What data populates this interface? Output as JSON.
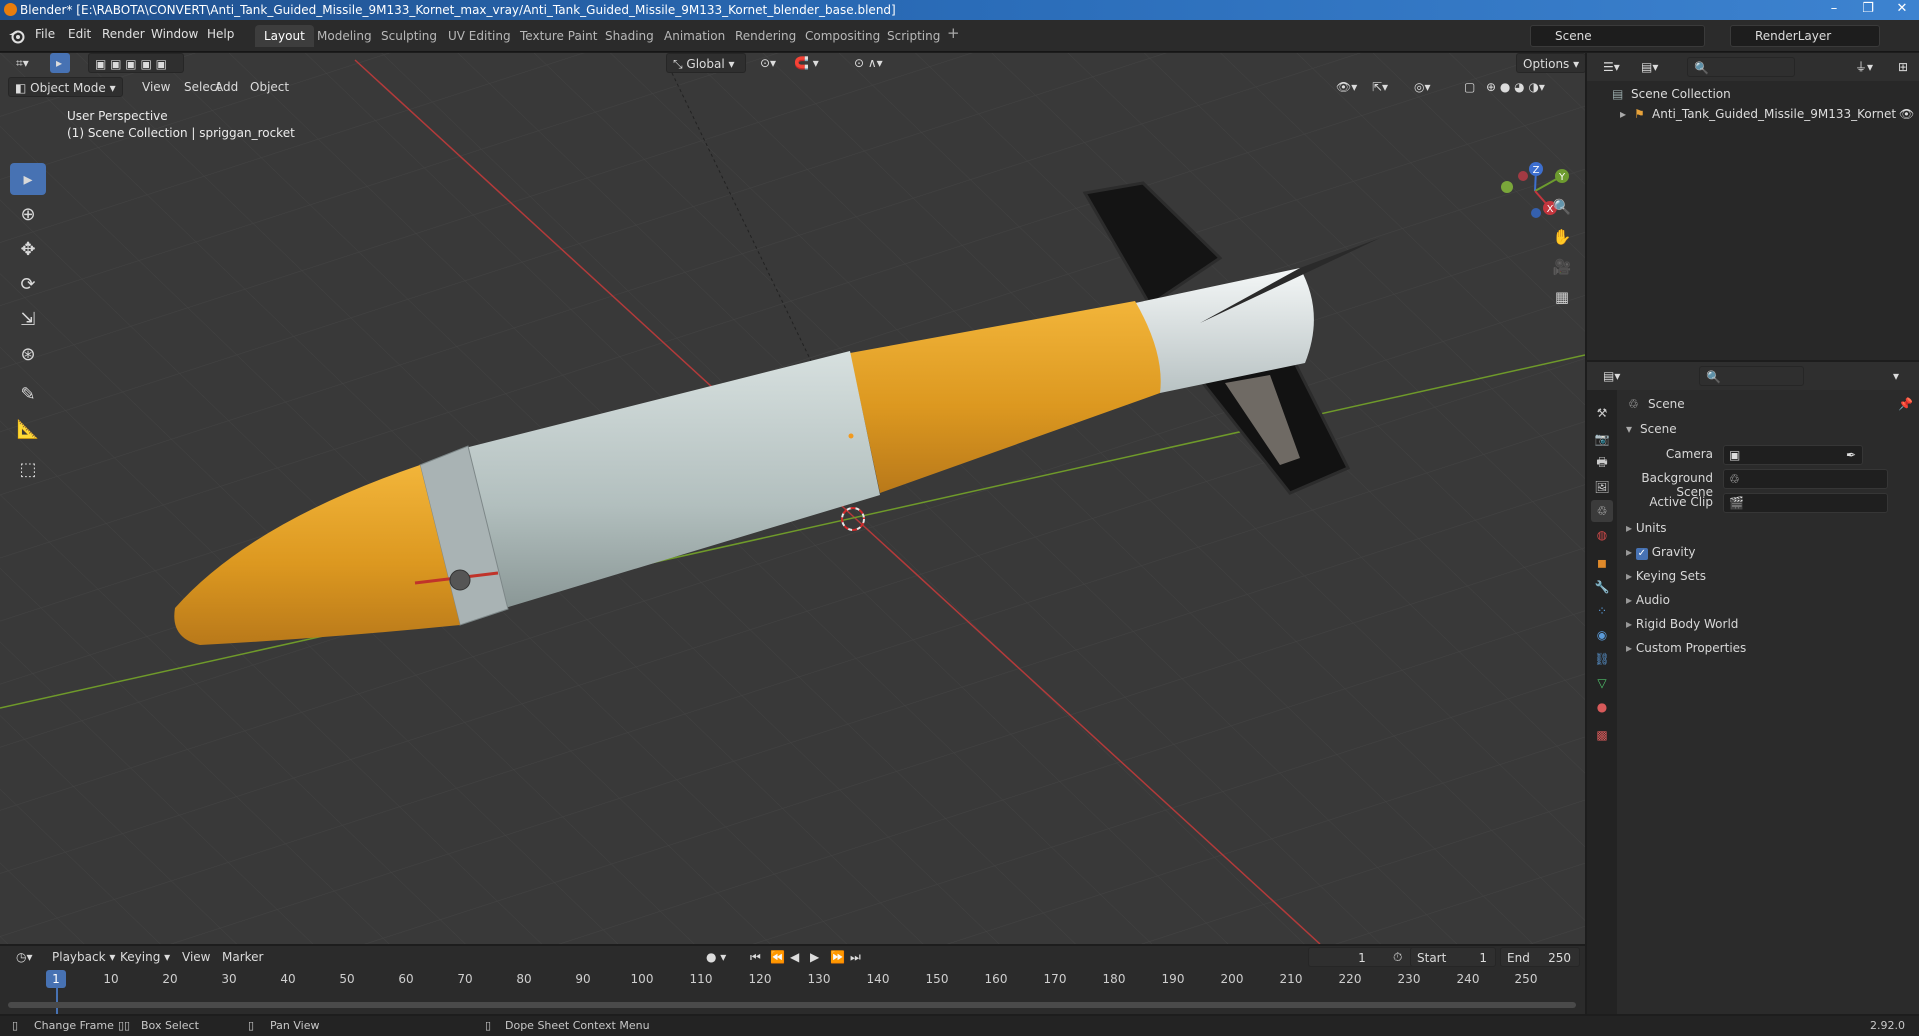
{
  "window": {
    "title": "Blender* [E:\\RABOTA\\CONVERT\\Anti_Tank_Guided_Missile_9M133_Kornet_max_vray/Anti_Tank_Guided_Missile_9M133_Kornet_blender_base.blend]",
    "controls": [
      "–",
      "❐",
      "✕"
    ]
  },
  "menu": {
    "items": [
      "File",
      "Edit",
      "Render",
      "Window",
      "Help"
    ],
    "workspaces": [
      "Layout",
      "Modeling",
      "Sculpting",
      "UV Editing",
      "Texture Paint",
      "Shading",
      "Animation",
      "Rendering",
      "Compositing",
      "Scripting"
    ],
    "active_workspace": "Layout",
    "add_workspace": "+",
    "scene": "Scene",
    "view_layer": "RenderLayer"
  },
  "viewport": {
    "mode": "Object Mode",
    "menus": [
      "View",
      "Select",
      "Add",
      "Object"
    ],
    "transform_orientation": "Global",
    "options": "Options",
    "perspective": "User Perspective",
    "context": "(1) Scene Collection | spriggan_rocket",
    "gizmo_axes": [
      "Z",
      "Y",
      "X"
    ],
    "colors": {
      "background": "#393939",
      "x_axis": "#b33a3a",
      "y_axis": "#6f9a2a",
      "body_orange": "#e3a22a",
      "body_grey": "#b7c4c3",
      "fin": "#1a1a1a"
    }
  },
  "outliner": {
    "root": "Scene Collection",
    "items": [
      {
        "label": "Anti_Tank_Guided_Missile_9M133_Kornet"
      }
    ]
  },
  "properties": {
    "context_title": "Scene",
    "section": "Scene",
    "fields": [
      {
        "label": "Camera"
      },
      {
        "label": "Background Scene"
      },
      {
        "label": "Active Clip"
      }
    ],
    "panels": [
      "Units",
      "Gravity",
      "Keying Sets",
      "Audio",
      "Rigid Body World",
      "Custom Properties"
    ],
    "gravity_checked": true
  },
  "timeline": {
    "menus": [
      "Playback",
      "Keying",
      "View",
      "Marker"
    ],
    "current_frame": "1",
    "start_label": "Start",
    "start": "1",
    "end_label": "End",
    "end": "250",
    "ruler_ticks": [
      "10",
      "20",
      "30",
      "40",
      "50",
      "60",
      "70",
      "80",
      "90",
      "100",
      "110",
      "120",
      "130",
      "140",
      "150",
      "160",
      "170",
      "180",
      "190",
      "200",
      "210",
      "220",
      "230",
      "240",
      "250"
    ],
    "playhead": "1"
  },
  "statusbar": {
    "hints": [
      "Change Frame",
      "Box Select",
      "Pan View",
      "Dope Sheet Context Menu"
    ],
    "version": "2.92.0"
  }
}
